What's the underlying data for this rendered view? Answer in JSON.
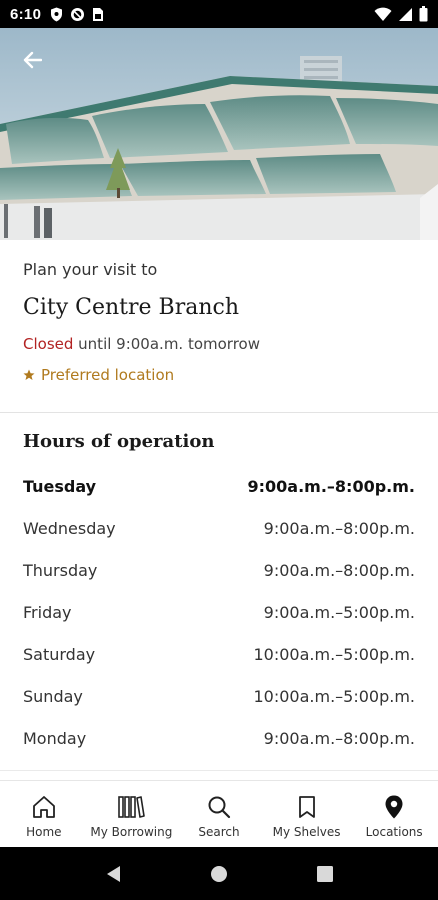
{
  "status_bar": {
    "time": "6:10"
  },
  "hero": {
    "back_icon": "arrow-left-icon"
  },
  "info": {
    "plan_visit": "Plan your visit to",
    "branch_name": "City Centre Branch",
    "status_closed": "Closed",
    "status_detail": "until 9:00a.m. tomorrow",
    "preferred": "Preferred location",
    "preferred_icon": "star-icon"
  },
  "hours": {
    "title": "Hours of operation",
    "rows": [
      {
        "day": "Tuesday",
        "time": "9:00a.m.–8:00p.m."
      },
      {
        "day": "Wednesday",
        "time": "9:00a.m.–8:00p.m."
      },
      {
        "day": "Thursday",
        "time": "9:00a.m.–8:00p.m."
      },
      {
        "day": "Friday",
        "time": "9:00a.m.–5:00p.m."
      },
      {
        "day": "Saturday",
        "time": "10:00a.m.–5:00p.m."
      },
      {
        "day": "Sunday",
        "time": "10:00a.m.–5:00p.m."
      },
      {
        "day": "Monday",
        "time": "9:00a.m.–8:00p.m."
      }
    ]
  },
  "bottom_nav": {
    "items": [
      {
        "label": "Home",
        "icon": "home-icon"
      },
      {
        "label": "My Borrowing",
        "icon": "books-icon"
      },
      {
        "label": "Search",
        "icon": "search-icon"
      },
      {
        "label": "My Shelves",
        "icon": "bookmark-icon"
      },
      {
        "label": "Locations",
        "icon": "location-pin-icon"
      }
    ],
    "active": "Locations"
  },
  "colors": {
    "closed": "#b22222",
    "preferred": "#b07a1e",
    "text": "#222222"
  }
}
